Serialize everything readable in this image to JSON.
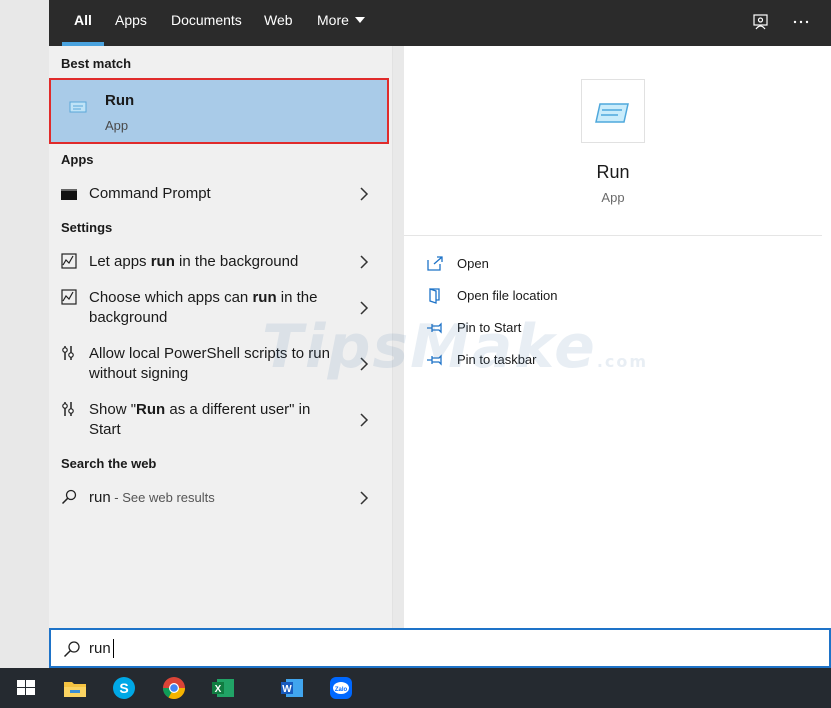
{
  "tabs": [
    "All",
    "Apps",
    "Documents",
    "Web",
    "More"
  ],
  "best_match": {
    "heading": "Best match",
    "title": "Run",
    "subtitle": "App"
  },
  "apps": {
    "heading": "Apps",
    "items": [
      {
        "label": "Command Prompt"
      }
    ]
  },
  "settings": {
    "heading": "Settings",
    "items": [
      {
        "pre": "Let apps ",
        "bold": "run",
        "post": " in the background"
      },
      {
        "pre": "Choose which apps can ",
        "bold": "run",
        "post": " in the background"
      },
      {
        "pre": "Allow local PowerShell scripts to run without signing",
        "bold": "",
        "post": ""
      },
      {
        "pre": "Show \"",
        "bold": "Run",
        "post": " as a different user\" in Start"
      }
    ]
  },
  "web": {
    "heading": "Search the web",
    "query": "run",
    "suffix": " - See web results"
  },
  "preview": {
    "title": "Run",
    "subtitle": "App",
    "actions": [
      "Open",
      "Open file location",
      "Pin to Start",
      "Pin to taskbar"
    ]
  },
  "watermark": {
    "main": "TipsMake",
    "suffix": ".com"
  },
  "search": {
    "value": "run"
  },
  "colors": {
    "accent": "#4aa3df",
    "selected_bg": "#a9cbe8",
    "highlight_border": "#e02b2b",
    "action_icon": "#1e73c8"
  },
  "icons": {
    "top": [
      "feedback-icon",
      "more-options-icon"
    ],
    "taskbar": [
      "windows-start-icon",
      "file-explorer-icon",
      "skype-icon",
      "chrome-icon",
      "excel-icon",
      "word-icon",
      "zalo-icon"
    ]
  }
}
